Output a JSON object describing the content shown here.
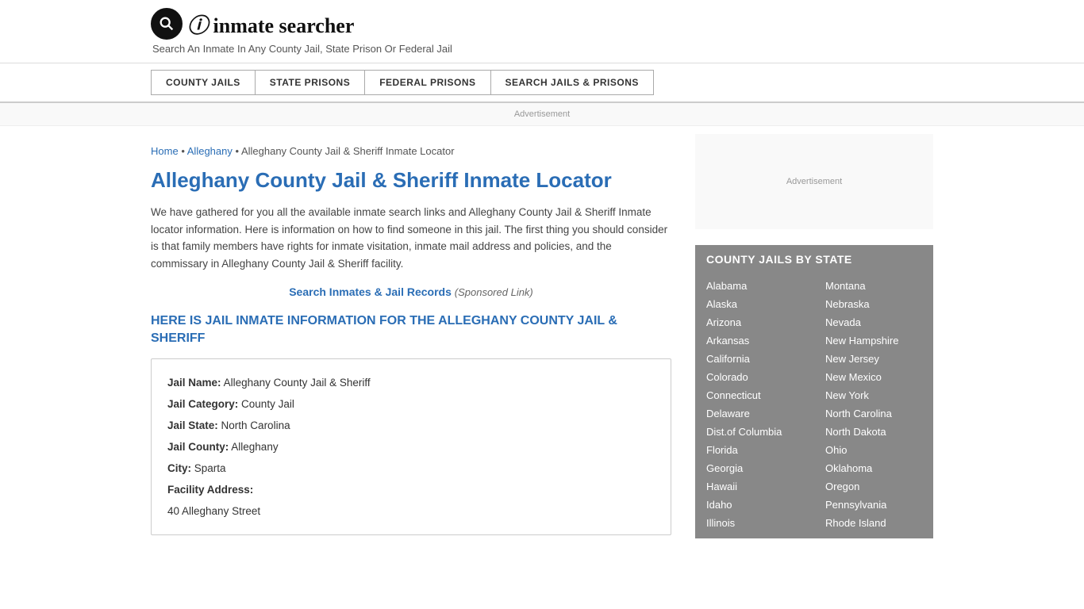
{
  "header": {
    "logo_text": "inmate searcher",
    "tagline": "Search An Inmate In Any County Jail, State Prison Or Federal Jail"
  },
  "nav": {
    "items": [
      {
        "label": "COUNTY JAILS",
        "id": "county-jails"
      },
      {
        "label": "STATE PRISONS",
        "id": "state-prisons"
      },
      {
        "label": "FEDERAL PRISONS",
        "id": "federal-prisons"
      },
      {
        "label": "SEARCH JAILS & PRISONS",
        "id": "search-jails-prisons"
      }
    ]
  },
  "ad_label": "Advertisement",
  "breadcrumb": {
    "home": "Home",
    "separator": "•",
    "alleghany": "Alleghany",
    "current": "Alleghany County Jail & Sheriff Inmate Locator"
  },
  "page_title": "Alleghany County Jail & Sheriff Inmate Locator",
  "description": "We have gathered for you all the available inmate search links and Alleghany County Jail & Sheriff Inmate locator information. Here is information on how to find someone in this jail. The first thing you should consider is that family members have rights for inmate visitation, inmate mail address and policies, and the commissary in Alleghany County Jail & Sheriff facility.",
  "search_link": {
    "text": "Search Inmates & Jail Records",
    "sponsored": "(Sponsored Link)"
  },
  "section_heading": "HERE IS JAIL INMATE INFORMATION FOR THE ALLEGHANY COUNTY JAIL & SHERIFF",
  "jail_info": {
    "name_label": "Jail Name:",
    "name_value": "Alleghany County Jail & Sheriff",
    "category_label": "Jail Category:",
    "category_value": "County Jail",
    "state_label": "Jail State:",
    "state_value": "North Carolina",
    "county_label": "Jail County:",
    "county_value": "Alleghany",
    "city_label": "City:",
    "city_value": "Sparta",
    "address_label": "Facility Address:",
    "address_value": "40 Alleghany Street"
  },
  "sidebar": {
    "ad_label": "Advertisement",
    "state_list_title": "COUNTY JAILS BY STATE",
    "states_left": [
      "Alabama",
      "Alaska",
      "Arizona",
      "Arkansas",
      "California",
      "Colorado",
      "Connecticut",
      "Delaware",
      "Dist.of Columbia",
      "Florida",
      "Georgia",
      "Hawaii",
      "Idaho",
      "Illinois"
    ],
    "states_right": [
      "Montana",
      "Nebraska",
      "Nevada",
      "New Hampshire",
      "New Jersey",
      "New Mexico",
      "New York",
      "North Carolina",
      "North Dakota",
      "Ohio",
      "Oklahoma",
      "Oregon",
      "Pennsylvania",
      "Rhode Island"
    ]
  }
}
